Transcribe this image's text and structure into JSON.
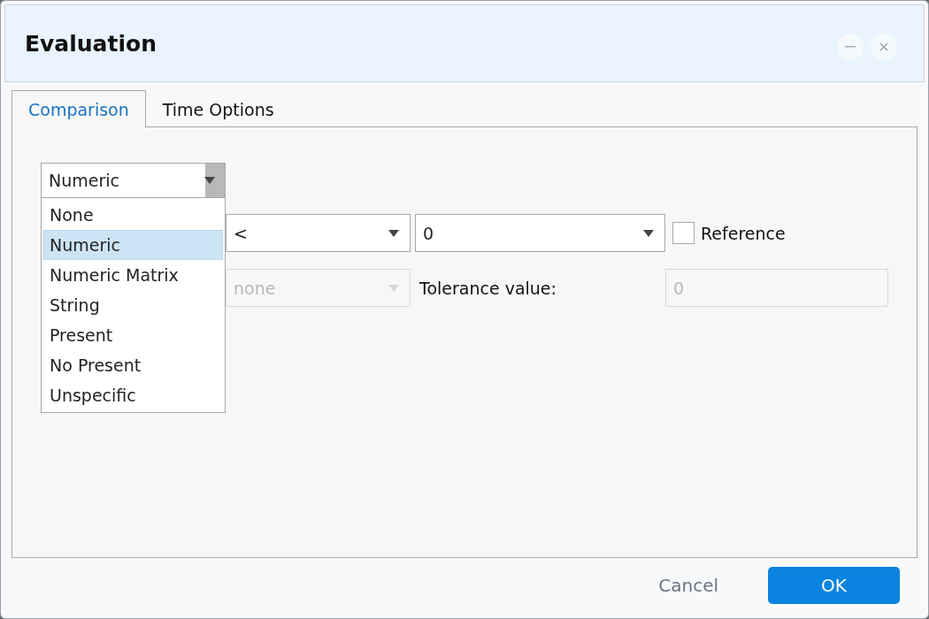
{
  "window": {
    "title": "Evaluation"
  },
  "tabs": [
    {
      "label": "Comparison",
      "selected": true
    },
    {
      "label": "Time Options",
      "selected": false
    }
  ],
  "type_select": {
    "value": "Numeric",
    "expanded": true,
    "options": [
      {
        "label": "None",
        "selected": false
      },
      {
        "label": "Numeric",
        "selected": true
      },
      {
        "label": "Numeric Matrix",
        "selected": false
      },
      {
        "label": "String",
        "selected": false
      },
      {
        "label": "Present",
        "selected": false
      },
      {
        "label": "No Present",
        "selected": false
      },
      {
        "label": "Unspecific",
        "selected": false
      }
    ]
  },
  "comparison_row": {
    "operator": "<",
    "value": "0",
    "reference": {
      "label": "Reference",
      "checked": false
    }
  },
  "tolerance_row": {
    "mode": "none",
    "disabled": true,
    "label": "Tolerance value:",
    "value": "0"
  },
  "buttons": [
    {
      "label": "Cancel",
      "kind": "secondary"
    },
    {
      "label": "OK",
      "kind": "primary"
    }
  ]
}
